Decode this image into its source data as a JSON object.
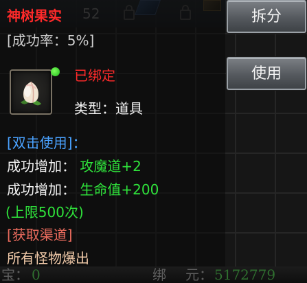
{
  "background": {
    "slot_count_text": "52"
  },
  "item": {
    "name": "神树果实",
    "success_rate": "[成功率：5%]",
    "bound_status": "已绑定",
    "type_label": "类型：",
    "type_value": "道具",
    "usage_header": "[双击使用]：",
    "effects": [
      {
        "label": "成功增加：",
        "value": "攻魔道+2"
      },
      {
        "label": "成功增加：",
        "value": "生命值+200"
      }
    ],
    "limit": "(上限500次)",
    "source_header": "[获取渠道]",
    "source_text": "所有怪物爆出",
    "icon": "peach-fruit-icon"
  },
  "buttons": {
    "split_label": "拆分",
    "use_label": "使用"
  },
  "currency": {
    "label1": "宝：",
    "value1": "0",
    "label2": "绑",
    "label3": "元：",
    "value2": "5172779"
  },
  "colors": {
    "name": "#ff2a2a",
    "bound": "#ff2a2a",
    "usage_header": "#4aa2ff",
    "effect_value": "#2fe33b",
    "source_header": "#e86a5c"
  }
}
